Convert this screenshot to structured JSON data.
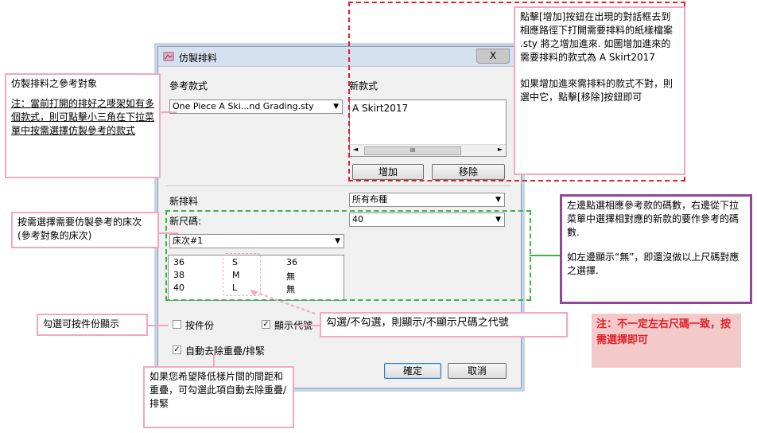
{
  "dialog": {
    "title": "仿製排料",
    "close_label": "X",
    "reference_style_label": "參考款式",
    "reference_style_value": "One Piece A Ski...nd Grading.sty",
    "new_style_label": "新款式",
    "new_style_items": [
      "A Skirt2017"
    ],
    "scroll_left": "◄",
    "scroll_mid": "III",
    "scroll_right": "►",
    "add_button": "增加",
    "remove_button": "移除",
    "new_marker_label": "新排料",
    "new_marker_value": "所有布種",
    "new_size_label": "新尺碼:",
    "new_size_value": "40",
    "bed_value": "床次#1",
    "size_rows": [
      {
        "ref": "36",
        "code": "S",
        "new": "36"
      },
      {
        "ref": "38",
        "code": "M",
        "new": "無"
      },
      {
        "ref": "40",
        "code": "L",
        "new": "無"
      }
    ],
    "by_piece_label": "按件份",
    "show_code_label": "顯示代號",
    "auto_remove_label": "自動去除重疊/排緊",
    "ok_button": "確定",
    "cancel_button": "取消",
    "check_mark": "✓"
  },
  "notes": {
    "ref_note_title": "仿製排料之參考對象",
    "ref_note_body": "注：當前打開的排好之嘜架如有多個款式，則可點擊小三角在下拉菜單中按需選擇仿製參考的款式",
    "add_note_1": "點擊[增加]按鈕在出現的對話框去到相應路徑下打開需要排料的紙樣檔案 .sty 將之增加進來. 如圖增加進來的需要排料的款式為 A Skirt2017",
    "add_note_2": "如果增加進來需排料的款式不對，則選中它，點擊[移除]按鈕即可",
    "bed_note": "按需選擇需要仿製參考的床次(參考對象的床次)",
    "size_note_1": "左邊點選相應參考款的碼數，右邊從下拉菜單中選擇相對應的新款的要作參考的碼數.",
    "size_note_2": "如左邊顯示“無”，即還沒做以上尺碼對應之選擇.",
    "warning": "注：不一定左右尺碼一致，按需選擇即可",
    "by_piece_note": "勾選可按件份顯示",
    "show_code_note": "勾選/不勾選，則顯示/不顯示尺碼之代號",
    "auto_remove_note": "如果您希望降低樣片間的間距和重疊，可勾選此項自動去除重疊/排緊"
  },
  "colors": {
    "pink": "#f2a7c3",
    "red": "#e0202a",
    "green": "#3db14a",
    "purple": "#8d4b96"
  }
}
